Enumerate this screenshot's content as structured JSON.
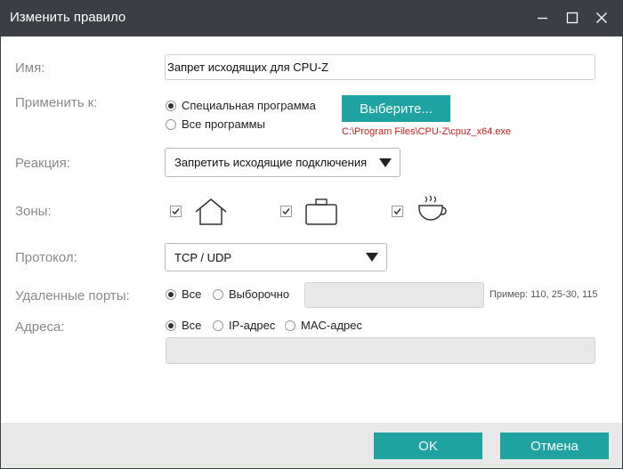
{
  "window": {
    "title": "Изменить правило"
  },
  "form": {
    "name_label": "Имя:",
    "name_value": "Запрет исходящих для CPU-Z",
    "apply_label": "Применить к:",
    "apply_options": [
      "Специальная программа",
      "Все программы"
    ],
    "apply_selected": 0,
    "browse_label": "Выберите...",
    "program_path": "C:\\Program Files\\CPU-Z\\cpuz_x64.exe",
    "reaction_label": "Реакция:",
    "reaction_value": "Запретить исходящие подключения",
    "zones_label": "Зоны:",
    "zones": [
      {
        "icon": "home-icon",
        "checked": true
      },
      {
        "icon": "briefcase-icon",
        "checked": true
      },
      {
        "icon": "coffee-cup-icon",
        "checked": true
      }
    ],
    "protocol_label": "Протокол:",
    "protocol_value": "TCP / UDP",
    "remote_ports_label": "Удаленные порты:",
    "remote_ports_options": [
      "Все",
      "Выборочно"
    ],
    "remote_ports_selected": 0,
    "remote_ports_value": "",
    "remote_ports_hint": "Пример: 110, 25-30, 115",
    "addresses_label": "Адреса:",
    "address_options": [
      "Все",
      "IP-адрес",
      "MAC-адрес"
    ],
    "address_selected": 0,
    "address_value": ""
  },
  "footer": {
    "ok_label": "OK",
    "cancel_label": "Отмена"
  },
  "colors": {
    "titlebar": "#3b3f45",
    "accent": "#1ea3a0",
    "path_text": "#cc1b1b",
    "footer_bg": "#e8e8e8"
  }
}
